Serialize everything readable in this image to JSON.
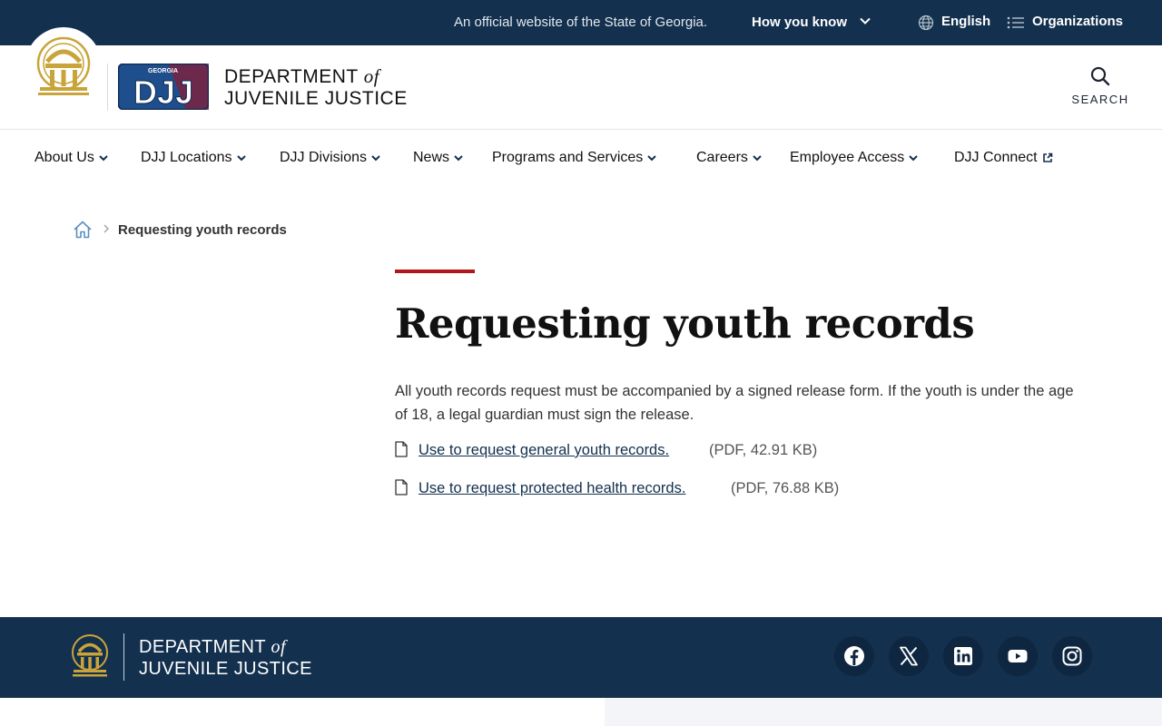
{
  "topbar": {
    "official_text": "An official website of the State of Georgia.",
    "how_you_know": "How you know",
    "language": "English",
    "organizations": "Organizations"
  },
  "header": {
    "logo_badge_small": "GEORGIA",
    "logo_badge": "DJJ",
    "dept_line1_a": "DEPARTMENT",
    "dept_line1_of": "of",
    "dept_line2": "JUVENILE JUSTICE",
    "search_label": "SEARCH"
  },
  "nav": {
    "items": [
      {
        "label": "About Us",
        "icon": "chevron-down-icon"
      },
      {
        "label": "DJJ Locations",
        "icon": "chevron-down-icon"
      },
      {
        "label": "DJJ Divisions",
        "icon": "chevron-down-icon"
      },
      {
        "label": "News",
        "icon": "chevron-down-icon"
      },
      {
        "label": "Programs and Services",
        "icon": "chevron-down-icon"
      },
      {
        "label": "Careers",
        "icon": "chevron-down-icon"
      },
      {
        "label": "Employee Access",
        "icon": "chevron-down-icon"
      },
      {
        "label": "DJJ Connect",
        "icon": "external-link-icon"
      }
    ]
  },
  "breadcrumb": {
    "current": "Requesting youth records"
  },
  "main": {
    "title": "Requesting youth records",
    "intro": "All youth records request must be accompanied by a signed release form. If the youth is under the age of 18, a legal guardian must sign the release.",
    "documents": [
      {
        "link": "Use to request general youth records.",
        "meta": "(PDF, 42.91 KB)"
      },
      {
        "link": "Use to request protected health records.",
        "meta": "(PDF, 76.88 KB)"
      }
    ]
  },
  "footer": {
    "dept_line1_a": "DEPARTMENT",
    "dept_line1_of": "of",
    "dept_line2": "JUVENILE JUSTICE",
    "social": [
      "facebook-icon",
      "x-icon",
      "linkedin-icon",
      "youtube-icon",
      "instagram-icon"
    ]
  },
  "colors": {
    "navy": "#13304e",
    "accent_red": "#b2161a",
    "gold": "#c9a43a"
  }
}
